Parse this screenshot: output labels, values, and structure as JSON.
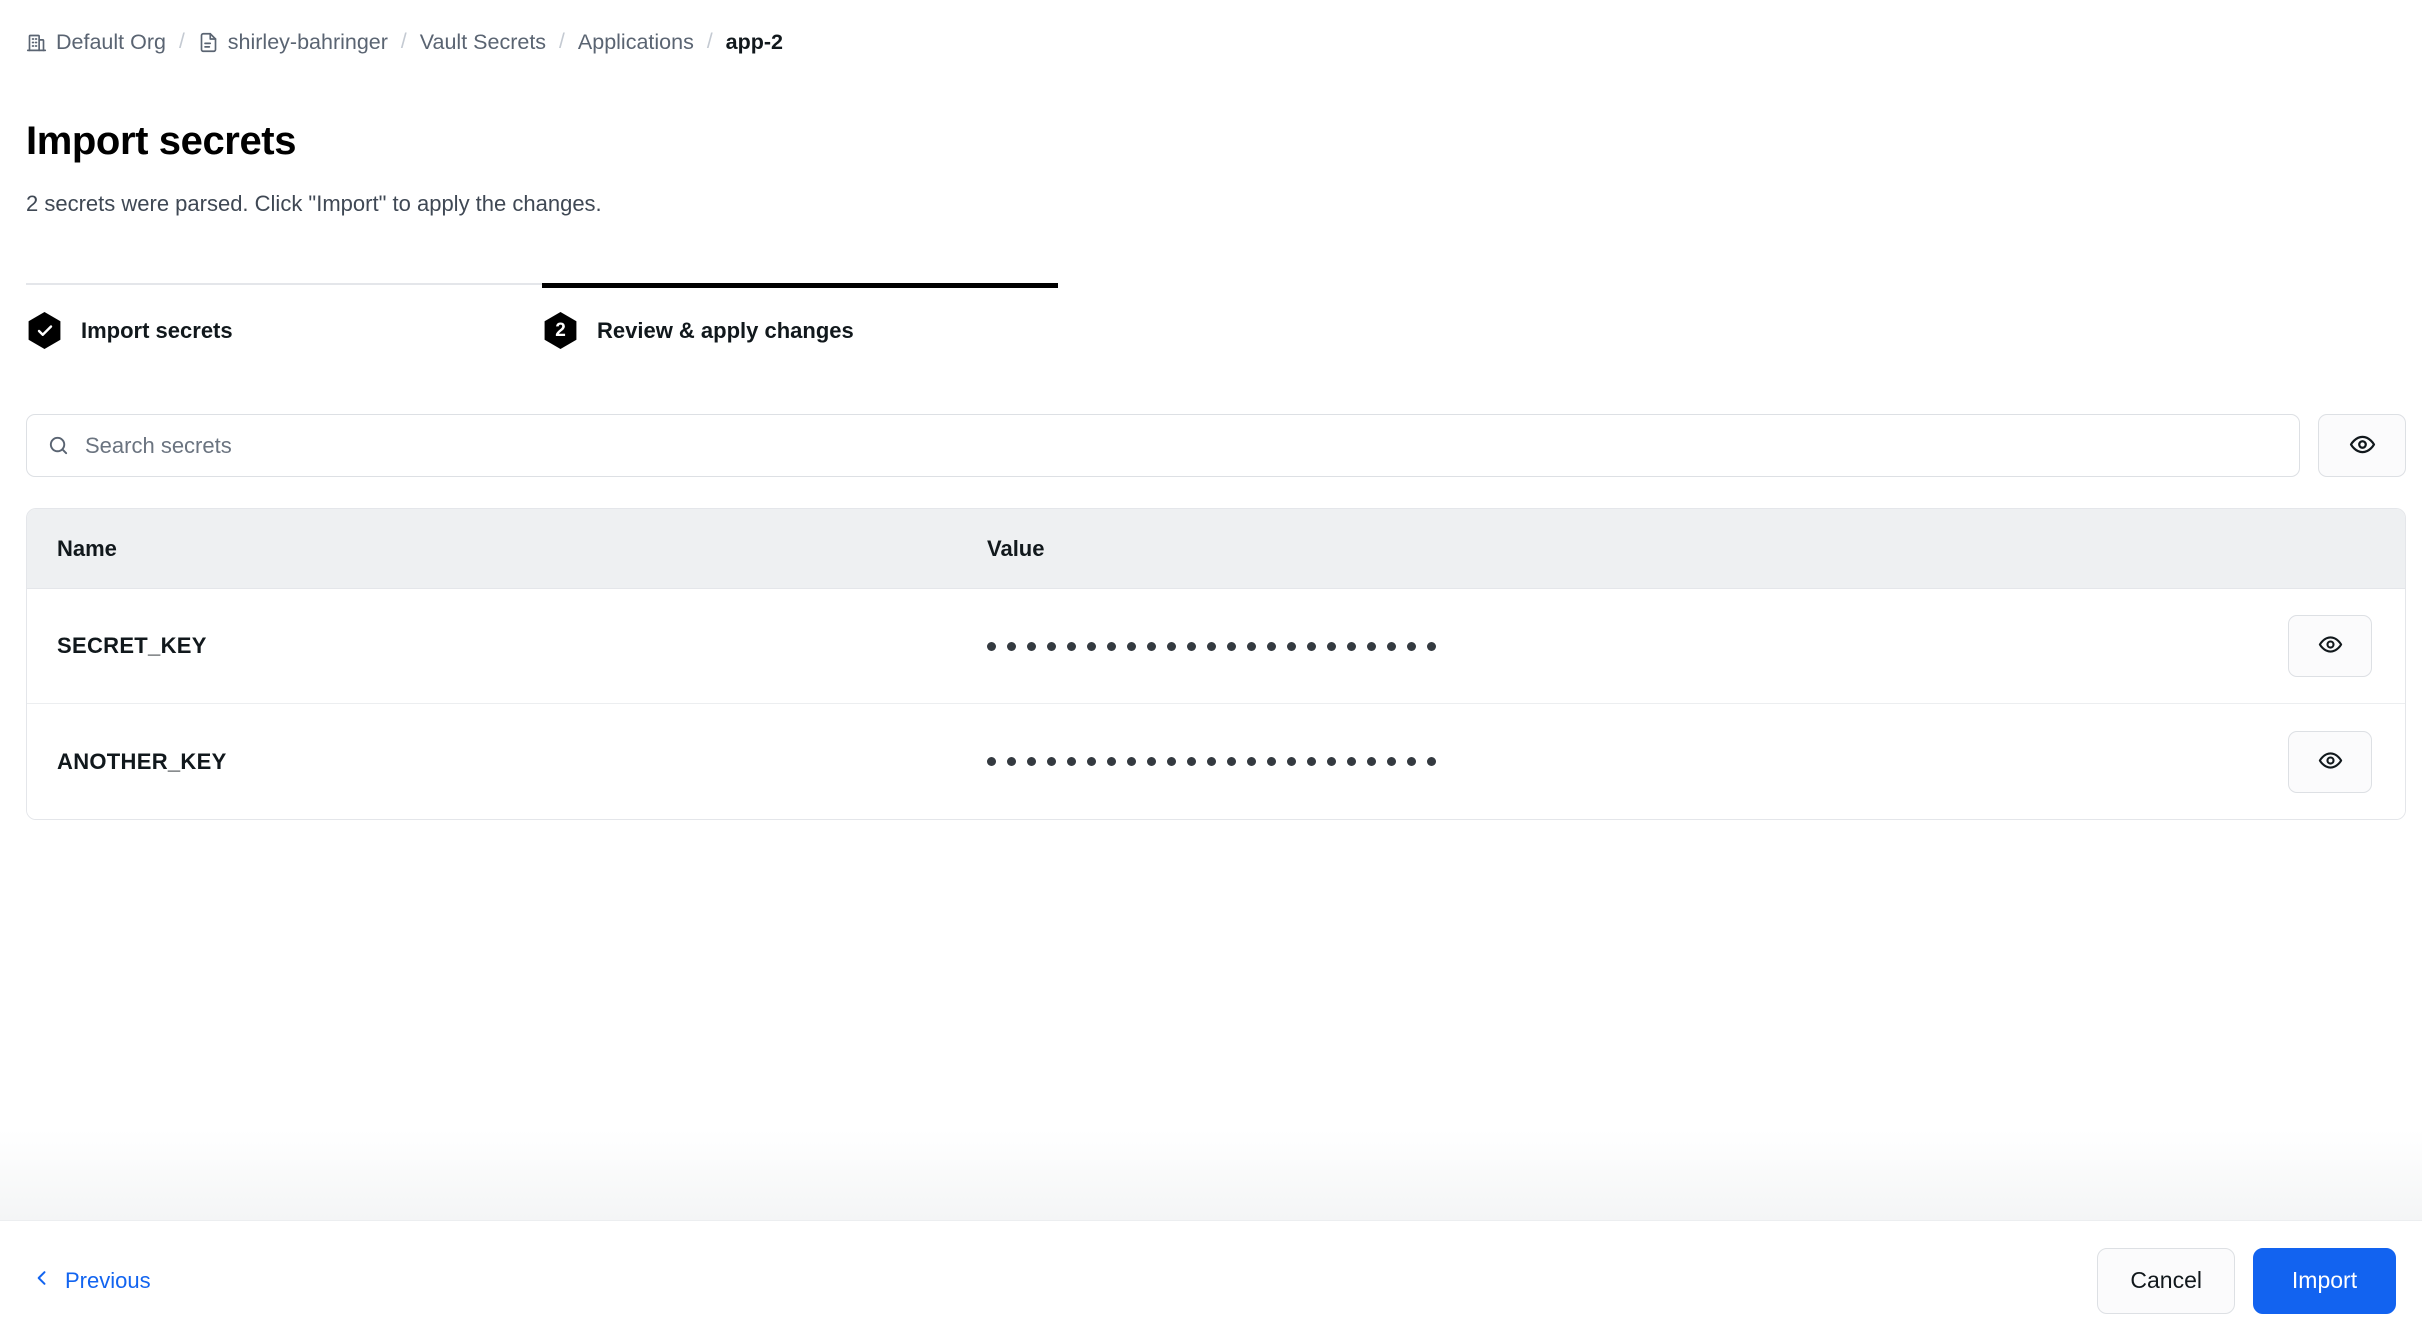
{
  "breadcrumb": {
    "items": [
      {
        "label": "Default Org",
        "icon": "building-icon",
        "current": false
      },
      {
        "label": "shirley-bahringer",
        "icon": "document-icon",
        "current": false
      },
      {
        "label": "Vault Secrets",
        "icon": null,
        "current": false
      },
      {
        "label": "Applications",
        "icon": null,
        "current": false
      },
      {
        "label": "app-2",
        "icon": null,
        "current": true
      }
    ],
    "separator": "/"
  },
  "header": {
    "title": "Import secrets",
    "subtitle": "2 secrets were parsed. Click \"Import\" to apply the changes."
  },
  "stepper": {
    "steps": [
      {
        "number": "1",
        "label": "Import secrets",
        "state": "complete",
        "glyph": "check-icon"
      },
      {
        "number": "2",
        "label": "Review & apply changes",
        "state": "active",
        "glyph": "2"
      }
    ]
  },
  "search": {
    "placeholder": "Search secrets",
    "value": "",
    "icon": "search-icon",
    "toggle_visibility_icon": "eye-icon"
  },
  "table": {
    "columns": [
      "Name",
      "Value"
    ],
    "rows": [
      {
        "name": "SECRET_KEY",
        "value_masked_length": 23,
        "action_icon": "eye-icon"
      },
      {
        "name": "ANOTHER_KEY",
        "value_masked_length": 23,
        "action_icon": "eye-icon"
      }
    ]
  },
  "footer": {
    "previous_label": "Previous",
    "previous_icon": "chevron-left-icon",
    "cancel_label": "Cancel",
    "import_label": "Import"
  },
  "colors": {
    "accent": "#1263f0",
    "link": "#1264f0",
    "step_active": "#000000",
    "table_header_bg": "#eef0f2",
    "border": "#e4e6ea"
  }
}
